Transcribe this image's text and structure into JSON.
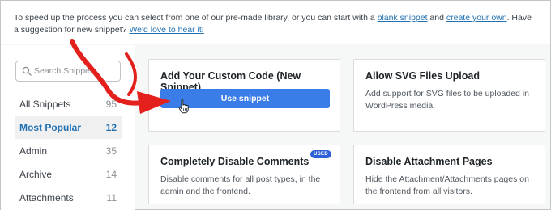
{
  "intro": {
    "text_1": "To speed up the process you can select from one of our pre-made library, or you can start with a ",
    "blank_link": "blank snippet",
    "text_2": " and ",
    "create_link": "create your own",
    "text_3": ". Have a suggestion for new snippet? ",
    "hear_link": "We'd love to hear it!"
  },
  "search": {
    "placeholder": "Search Snippets"
  },
  "categories": [
    {
      "label": "All Snippets",
      "count": "95"
    },
    {
      "label": "Most Popular",
      "count": "12"
    },
    {
      "label": "Admin",
      "count": "35"
    },
    {
      "label": "Archive",
      "count": "14"
    },
    {
      "label": "Attachments",
      "count": "11"
    }
  ],
  "cards": [
    {
      "title": "Add Your Custom Code (New Snippet)",
      "button": "Use snippet"
    },
    {
      "title": "Allow SVG Files Upload",
      "description": "Add support for SVG files to be uploaded in WordPress media."
    },
    {
      "title": "Completely Disable Comments",
      "description": "Disable comments for all post types, in the admin and the frontend.",
      "badge": "USED"
    },
    {
      "title": "Disable Attachment Pages",
      "description": "Hide the Attachment/Attachments pages on the frontend from all visitors."
    }
  ],
  "colors": {
    "accent": "#2271b1",
    "button": "#3b7de8",
    "arrow": "#e3201b"
  }
}
